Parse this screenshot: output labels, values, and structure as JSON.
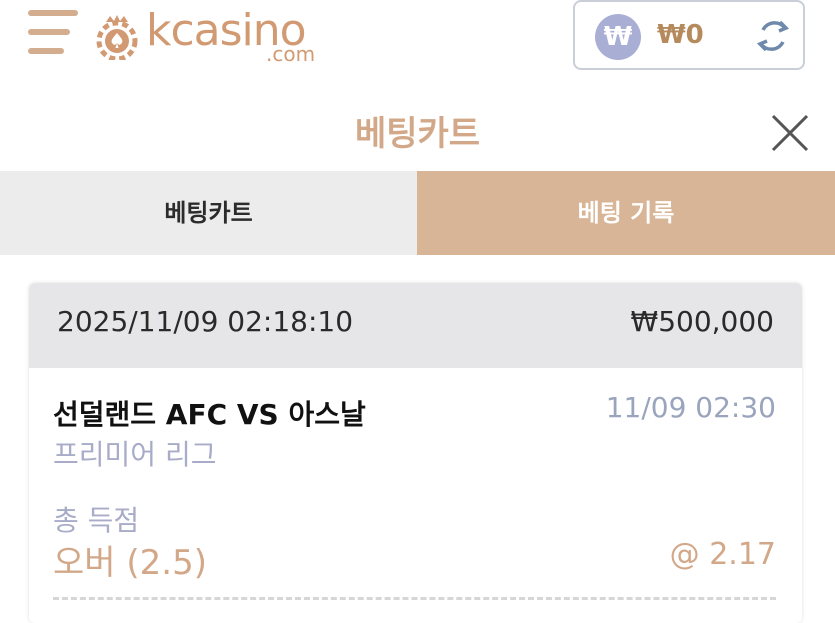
{
  "header": {
    "logo_text": "kcasino",
    "logo_sub": ".com",
    "currency_badge": "₩",
    "balance": "₩0"
  },
  "panel": {
    "title": "베팅카트"
  },
  "tabs": [
    {
      "label": "베팅카트",
      "active": false
    },
    {
      "label": "베팅 기록",
      "active": true
    }
  ],
  "bet": {
    "datetime": "2025/11/09 02:18:10",
    "amount": "₩500,000",
    "match": "선덜랜드 AFC VS 아스날",
    "match_time": "11/09 02:30",
    "league": "프리미어 리그",
    "market": "총 득점",
    "selection": "오버 (2.5)",
    "odds": "@ 2.17"
  },
  "colors": {
    "accent": "#d8b597",
    "accent_text": "#d2a889",
    "muted_blue": "#a8acc8",
    "tab_inactive": "#ececed",
    "card_header": "#e6e6e8"
  },
  "icons": {
    "menu": "hamburger-icon",
    "logo": "casino-chip-icon",
    "currency": "won-icon",
    "refresh": "refresh-icon",
    "close": "close-icon"
  }
}
